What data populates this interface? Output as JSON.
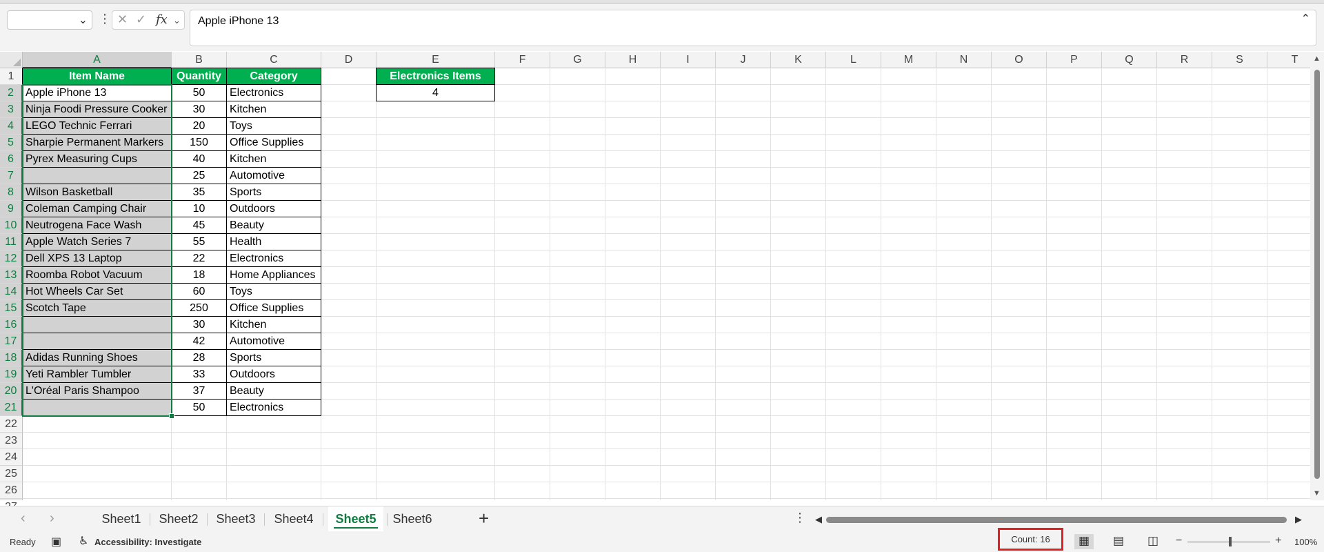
{
  "formula_bar": {
    "name_box": "",
    "function_label": "fx",
    "cancel_glyph": "✕",
    "enter_glyph": "✓",
    "content": "Apple iPhone 13"
  },
  "columns": [
    "A",
    "B",
    "C",
    "D",
    "E",
    "F",
    "G",
    "H",
    "I",
    "J",
    "K",
    "L",
    "M",
    "N",
    "O",
    "P",
    "Q",
    "R",
    "S",
    "T"
  ],
  "rows": [
    "1",
    "2",
    "3",
    "4",
    "5",
    "6",
    "7",
    "8",
    "9",
    "10",
    "11",
    "12",
    "13",
    "14",
    "15",
    "16",
    "17",
    "18",
    "19",
    "20",
    "21",
    "22",
    "23",
    "24",
    "25",
    "26",
    "27"
  ],
  "table": {
    "headers": [
      "Item Name",
      "Quantity",
      "Category"
    ],
    "items": [
      [
        "Apple iPhone 13",
        "50",
        "Electronics"
      ],
      [
        "Ninja Foodi Pressure Cooker",
        "30",
        "Kitchen"
      ],
      [
        "LEGO Technic Ferrari",
        "20",
        "Toys"
      ],
      [
        "Sharpie Permanent Markers",
        "150",
        "Office Supplies"
      ],
      [
        "Pyrex Measuring Cups",
        "40",
        "Kitchen"
      ],
      [
        "",
        "25",
        "Automotive"
      ],
      [
        "Wilson Basketball",
        "35",
        "Sports"
      ],
      [
        "Coleman Camping Chair",
        "10",
        "Outdoors"
      ],
      [
        "Neutrogena Face Wash",
        "45",
        "Beauty"
      ],
      [
        "Apple Watch Series 7",
        "55",
        "Health"
      ],
      [
        "Dell XPS 13 Laptop",
        "22",
        "Electronics"
      ],
      [
        "Roomba Robot Vacuum",
        "18",
        "Home Appliances"
      ],
      [
        "Hot Wheels Car Set",
        "60",
        "Toys"
      ],
      [
        "Scotch Tape",
        "250",
        "Office Supplies"
      ],
      [
        "",
        "30",
        "Kitchen"
      ],
      [
        "",
        "42",
        "Automotive"
      ],
      [
        "Adidas Running Shoes",
        "28",
        "Sports"
      ],
      [
        "Yeti Rambler Tumbler",
        "33",
        "Outdoors"
      ],
      [
        "L'Oréal Paris Shampoo",
        "37",
        "Beauty"
      ],
      [
        "",
        "50",
        "Electronics"
      ]
    ]
  },
  "summary": {
    "header": "Electronics Items",
    "value": "4"
  },
  "sheets": [
    "Sheet1",
    "Sheet2",
    "Sheet3",
    "Sheet4",
    "Sheet5",
    "Sheet6"
  ],
  "active_sheet": "Sheet5",
  "status": {
    "ready": "Ready",
    "accessibility": "Accessibility: Investigate",
    "count": "Count: 16",
    "zoom": "100%"
  },
  "colors": {
    "header_green": "#00b050",
    "excel_green": "#107c41",
    "highlight_red": "#e02020"
  }
}
